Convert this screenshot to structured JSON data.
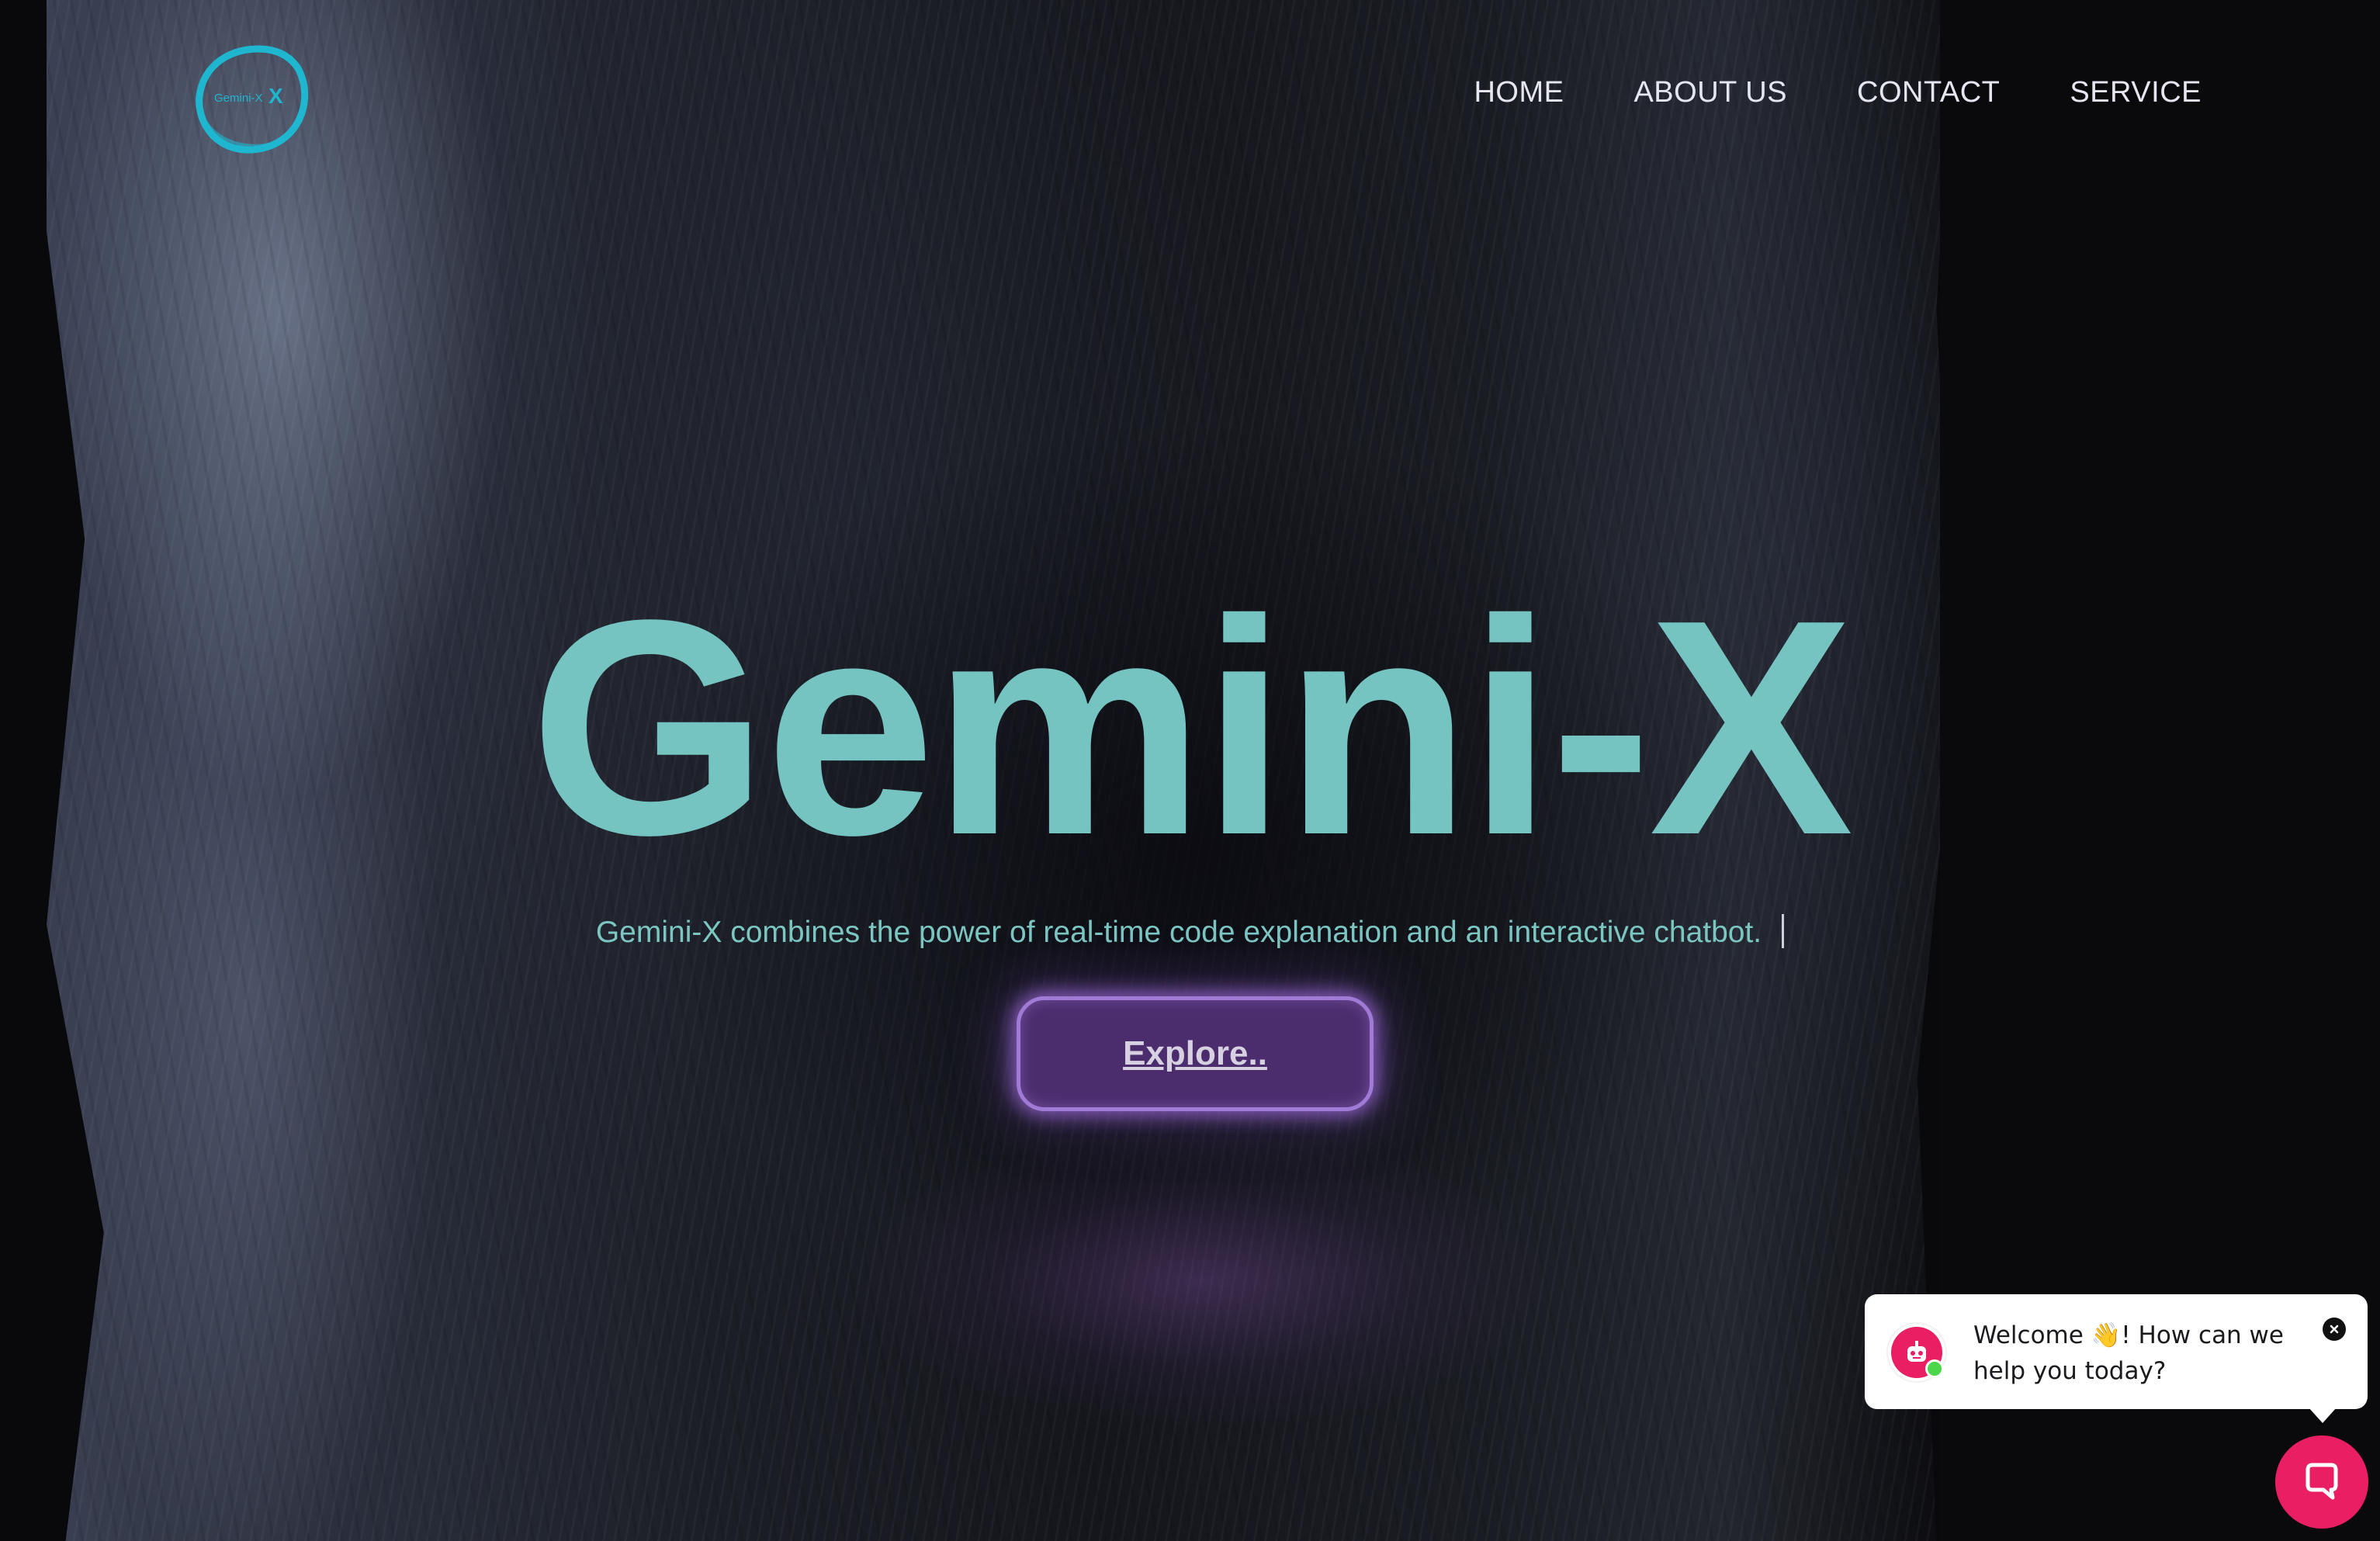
{
  "brand": {
    "logo_text": "Gemini-X",
    "logo_mark": "X"
  },
  "nav": {
    "items": [
      {
        "label": "HOME"
      },
      {
        "label": "ABOUT US"
      },
      {
        "label": "CONTACT"
      },
      {
        "label": "SERVICE"
      }
    ]
  },
  "hero": {
    "title": "Gemini-X",
    "subtitle": "Gemini-X combines the power of real-time code explanation and an interactive chatbot.",
    "cta_label": "Explore.."
  },
  "chat_widget": {
    "message": "Welcome 👋! How can we help you today?",
    "avatar_icon": "robot-icon",
    "close_icon": "close-icon",
    "launcher_icon": "chat-bubble-icon",
    "accent_color": "#e91e63",
    "online_color": "#4cd64c"
  },
  "colors": {
    "title": "#76c4c1",
    "logo": "#1fb6cf",
    "button_bg": "#4b2d6e",
    "button_border": "#a17ad6"
  }
}
